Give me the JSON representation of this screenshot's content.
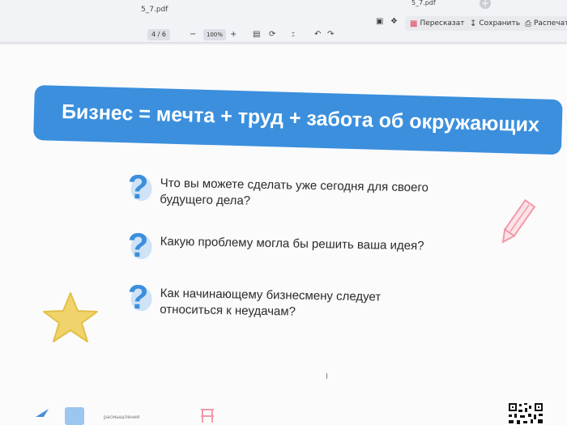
{
  "browser": {
    "file_title": "5_7.pdf",
    "tab_title": "5_7.pdf",
    "tab_add_label": "+"
  },
  "toolbar": {
    "retell_label": "Пересказать",
    "save_label": "Сохранить",
    "print_label": "Распечатат",
    "page_info": "4 / 6",
    "zoom_minus": "−",
    "zoom_value": "100%",
    "zoom_plus": "+"
  },
  "slide": {
    "banner_title": "Бизнес = мечта + труд + забота об окружающих",
    "question_mark": "?",
    "questions": [
      {
        "line1": "Что вы можете сделать уже сегодня для своего",
        "line2": "будущего дела?"
      },
      {
        "line1": "Какую проблему могла бы решить ваша идея?",
        "line2": ""
      },
      {
        "line1": "Как начинающему бизнесмену следует",
        "line2": "относиться к неудачам?"
      }
    ]
  },
  "footer": {
    "small_text": "расмышления"
  },
  "colors": {
    "accent_blue": "#3b8fdd",
    "star_yellow": "#f0d36a",
    "pencil_pink": "#f19aa8"
  }
}
